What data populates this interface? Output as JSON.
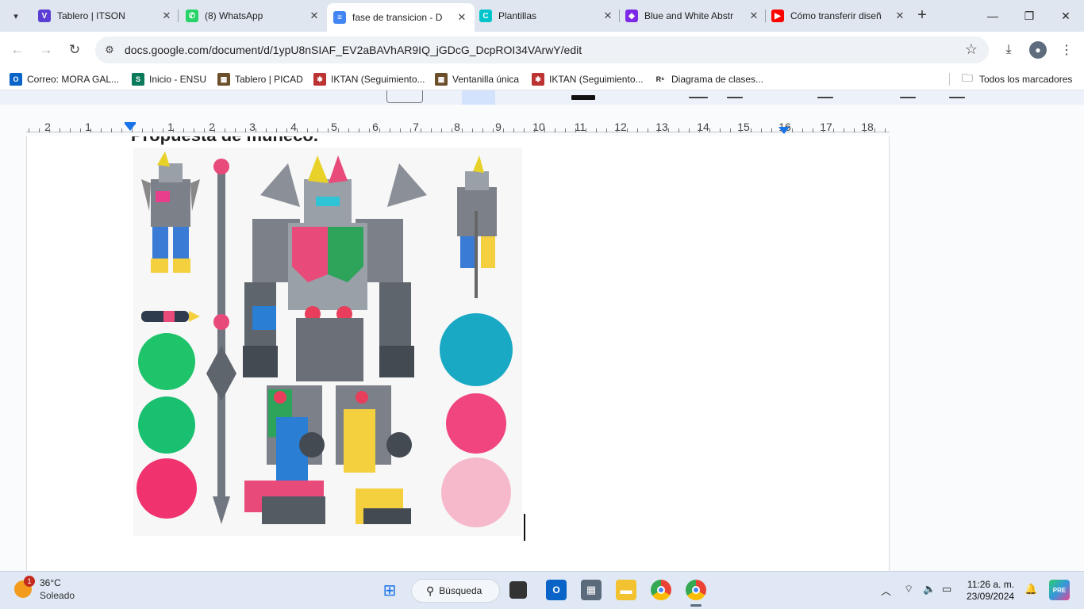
{
  "browser": {
    "tabs": [
      {
        "title": "Tablero | ITSON",
        "favicon_color": "#5b3fd4",
        "favicon_glyph": "V",
        "active": false
      },
      {
        "title": "(8) WhatsApp",
        "favicon_color": "#25d366",
        "favicon_glyph": "✆",
        "active": false
      },
      {
        "title": "fase de transicion - D",
        "favicon_color": "#4285f4",
        "favicon_glyph": "≡",
        "active": true
      },
      {
        "title": "Plantillas",
        "favicon_color": "#00c4cc",
        "favicon_glyph": "C",
        "active": false
      },
      {
        "title": "Blue and White Abstr",
        "favicon_color": "#7d2ae8",
        "favicon_glyph": "◆",
        "active": false
      },
      {
        "title": "Cómo transferir diseñ",
        "favicon_color": "#ff0000",
        "favicon_glyph": "▶",
        "active": false
      }
    ],
    "url": "docs.google.com/document/d/1ypU8nSIAF_EV2aBAVhAR9IQ_jGDcG_DcpROI34VArwY/edit",
    "bookmarks": [
      {
        "label": "Correo: MORA GAL...",
        "icon_color": "#0a64c8",
        "glyph": "O"
      },
      {
        "label": "Inicio - ENSU",
        "icon_color": "#0b7a5b",
        "glyph": "S"
      },
      {
        "label": "Tablero | PICAD",
        "icon_color": "#6b4f2a",
        "glyph": "▦"
      },
      {
        "label": "IKTAN (Seguimiento...",
        "icon_color": "#b33",
        "glyph": "✱"
      },
      {
        "label": "Ventanilla única",
        "icon_color": "#6b4f2a",
        "glyph": "▦"
      },
      {
        "label": "IKTAN (Seguimiento...",
        "icon_color": "#b33",
        "glyph": "✱"
      },
      {
        "label": "Diagrama de clases...",
        "icon_color": "#ffffff",
        "glyph": "R⁶"
      }
    ],
    "all_bookmarks_label": "Todos los marcadores"
  },
  "ruler": {
    "numbers": [
      "2",
      "1",
      "1",
      "2",
      "3",
      "4",
      "5",
      "6",
      "7",
      "8",
      "9",
      "10",
      "11",
      "12",
      "13",
      "14",
      "15",
      "16",
      "17",
      "18"
    ]
  },
  "document": {
    "heading_partial": "Propuesta de muñeco."
  },
  "taskbar": {
    "weather_temp": "36°C",
    "weather_desc": "Soleado",
    "weather_badge": "1",
    "search_label": "Búsqueda",
    "time": "11:26 a. m.",
    "date": "23/09/2024"
  }
}
